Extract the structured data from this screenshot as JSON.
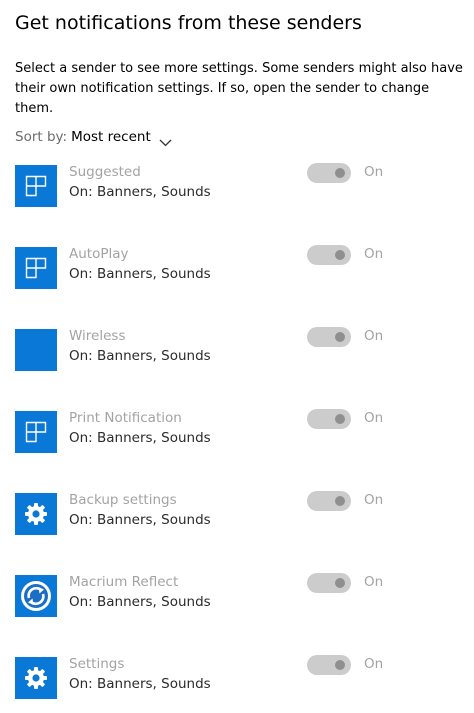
{
  "heading": "Get notifications from these senders",
  "description": "Select a sender to see more settings. Some senders might also have their own notification settings. If so, open the sender to change them.",
  "sort": {
    "label": "Sort by:",
    "value": "Most recent"
  },
  "senders": [
    {
      "name": "Suggested",
      "status": "On: Banners, Sounds",
      "toggle_label": "On",
      "toggle_on": true,
      "icon": "tiles-icon"
    },
    {
      "name": "AutoPlay",
      "status": "On: Banners, Sounds",
      "toggle_label": "On",
      "toggle_on": true,
      "icon": "tiles-icon"
    },
    {
      "name": "Wireless",
      "status": "On: Banners, Sounds",
      "toggle_label": "On",
      "toggle_on": true,
      "icon": "blank-tile-icon"
    },
    {
      "name": "Print Notification",
      "status": "On: Banners, Sounds",
      "toggle_label": "On",
      "toggle_on": true,
      "icon": "tiles-icon"
    },
    {
      "name": "Backup settings",
      "status": "On: Banners, Sounds",
      "toggle_label": "On",
      "toggle_on": true,
      "icon": "gear-icon"
    },
    {
      "name": "Macrium Reflect",
      "status": "On: Banners, Sounds",
      "toggle_label": "On",
      "toggle_on": true,
      "icon": "macrium-reflect-icon"
    },
    {
      "name": "Settings",
      "status": "On: Banners, Sounds",
      "toggle_label": "On",
      "toggle_on": true,
      "icon": "gear-icon"
    }
  ],
  "colors": {
    "accent": "#0a78d7",
    "toggle_off_track": "#cccccc",
    "toggle_knob": "#8f8f8f",
    "disabled_text": "#a3a3a3"
  }
}
